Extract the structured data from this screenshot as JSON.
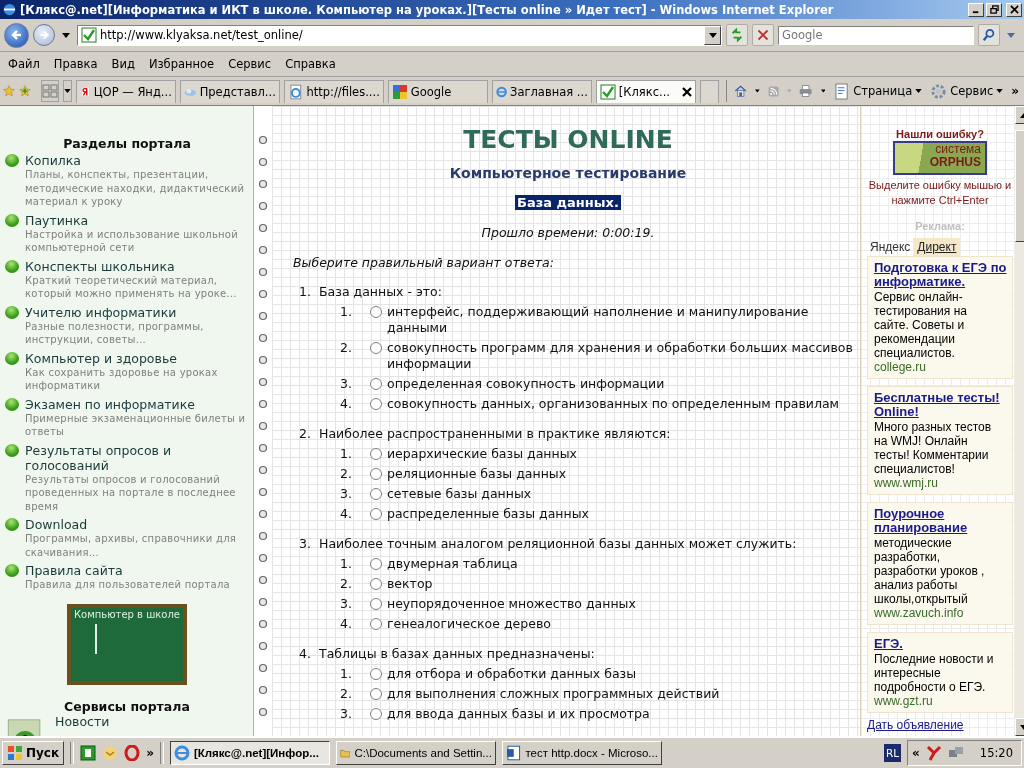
{
  "window": {
    "title": "[Клякс@.net][Информатика и ИКТ в школе. Компьютер на уроках.][Тесты online » Идет тест] - Windows Internet Explorer"
  },
  "nav": {
    "address": "http://www.klyaksa.net/test_online/",
    "search_placeholder": "Google"
  },
  "menu": [
    "Файл",
    "Правка",
    "Вид",
    "Избранное",
    "Сервис",
    "Справка"
  ],
  "tabs": [
    {
      "label": "ЦОР — Янд...",
      "selected": false
    },
    {
      "label": "Представл...",
      "selected": false
    },
    {
      "label": "http://files....",
      "selected": false
    },
    {
      "label": "Google",
      "selected": false
    },
    {
      "label": "Заглавная ...",
      "selected": false
    },
    {
      "label": "[Клякс...",
      "selected": true
    }
  ],
  "command_bar": {
    "page": "Страница",
    "tools": "Сервис",
    "more": "»"
  },
  "sidebar": {
    "heading": "Разделы портала",
    "items": [
      {
        "title": "Копилка",
        "description": "Планы, конспекты, презентации, методические находки, дидактический материал к уроку"
      },
      {
        "title": "Паутинка",
        "description": "Настройка и использование школьной компьютерной сети"
      },
      {
        "title": "Конспекты школьника",
        "description": "Краткий теоретический материал, который можно применять на уроке..."
      },
      {
        "title": "Учителю информатики",
        "description": "Разные полезности, программы, инструкции, советы..."
      },
      {
        "title": "Компьютер и здоровье",
        "description": "Как сохранить здоровье на уроках информатики"
      },
      {
        "title": "Экзамен по информатике",
        "description": "Примерные экзаменационные билеты и ответы"
      },
      {
        "title": "Результаты опросов и голосований",
        "description": "Результаты опросов и голосований проведенных на портале в последнее время"
      },
      {
        "title": "Download",
        "description": "Программы, архивы, справочники для скачивания..."
      },
      {
        "title": "Правила сайта",
        "description": "Правила для пользователей портала"
      }
    ],
    "board_caption": "Компьютер в школе",
    "services_heading": "Сервисы портала",
    "services": [
      "Новости"
    ]
  },
  "main": {
    "title": "ТЕСТЫ ONLINE",
    "subtitle": "Компьютерное тестирование",
    "topic": "База данных.",
    "elapsed": "Прошло времени: 0:00:19.",
    "instruction": "Выберите правильный вариант ответа:",
    "questions": [
      {
        "number": "1.",
        "text": "База данных - это:",
        "options": [
          {
            "number": "1.",
            "text": "интерфейс, поддерживающий наполнение и манипулирование данными",
            "selected": false
          },
          {
            "number": "2.",
            "text": "совокупность программ для хранения и обработки больших массивов информации",
            "selected": false
          },
          {
            "number": "3.",
            "text": "определенная совокупность информации",
            "selected": false
          },
          {
            "number": "4.",
            "text": "совокупность данных, организованных по определенным правилам",
            "selected": false
          }
        ]
      },
      {
        "number": "2.",
        "text": "Наиболее распространенными в практике являются:",
        "options": [
          {
            "number": "1.",
            "text": "иерархические базы данных",
            "selected": false
          },
          {
            "number": "2.",
            "text": "реляционные базы данных",
            "selected": false
          },
          {
            "number": "3.",
            "text": "сетевые базы данных",
            "selected": false
          },
          {
            "number": "4.",
            "text": "распределенные базы данных",
            "selected": false
          }
        ]
      },
      {
        "number": "3.",
        "text": "Наиболее точным аналогом реляционной базы данных может служить:",
        "options": [
          {
            "number": "1.",
            "text": "двумерная таблица",
            "selected": false
          },
          {
            "number": "2.",
            "text": "вектор",
            "selected": false
          },
          {
            "number": "3.",
            "text": "неупорядоченное множество данных",
            "selected": false
          },
          {
            "number": "4.",
            "text": "генеалогическое дерево",
            "selected": false
          }
        ]
      },
      {
        "number": "4.",
        "text": "Таблицы в базах данных предназначены:",
        "options": [
          {
            "number": "1.",
            "text": "для отбора и обработки данных базы",
            "selected": false
          },
          {
            "number": "2.",
            "text": "для выполнения сложных программных действий",
            "selected": false
          },
          {
            "number": "3.",
            "text": "для ввода данных базы и их просмотра",
            "selected": false
          }
        ]
      }
    ]
  },
  "right": {
    "error_heading": "Нашли ошибку?",
    "logo_top": "система",
    "logo_bottom": "ORPHUS",
    "error_hint": "Выделите ошибку мышью и нажмите Ctrl+Enter",
    "ads_label": "Реклама:",
    "ads_brand": "Яндекс",
    "ads_brand_tab": "Директ",
    "ads": [
      {
        "title": "Подготовка к ЕГЭ по информатике.",
        "text": "Сервис онлайн-тестирования на сайте. Советы и рекомендации специалистов.",
        "url": "college.ru"
      },
      {
        "title": "Бесплатные тесты! Online!",
        "text": "Много разных тестов на WMJ! Онлайн тесты! Комментарии специалистов!",
        "url": "www.wmj.ru"
      },
      {
        "title": "Поурочное планирование",
        "text": "методические разработки, разработки уроков , анализ работы школы,открытый",
        "url": "www.zavuch.info"
      },
      {
        "title": "ЕГЭ.",
        "text": "Последние новости и интересные подробности о ЕГЭ.",
        "url": "www.gzt.ru"
      }
    ],
    "place_ad": "Дать объявление"
  },
  "taskbar": {
    "start": "Пуск",
    "more": "»",
    "tasks": [
      {
        "label": "[Клякс@.net][Инфор...",
        "selected": true
      },
      {
        "label": "C:\\Documents and Settin...",
        "selected": false
      },
      {
        "label": "тест http.docx - Microso...",
        "selected": false
      }
    ],
    "lang": "RL",
    "tray_toggle": "«",
    "clock": "15:20"
  }
}
